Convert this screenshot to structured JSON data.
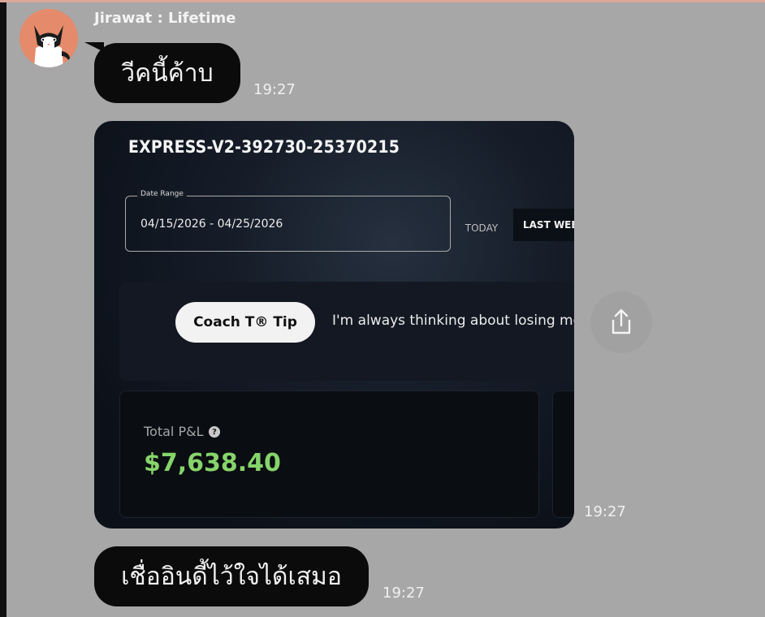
{
  "chat": {
    "sender": "Jirawat : Lifetime",
    "messages": [
      {
        "text": "วีคนี้ค้าบ",
        "time": "19:27"
      },
      {
        "time": "19:27"
      },
      {
        "text": "เชื่ออินดี้ไว้ใจได้เสมอ",
        "time": "19:27"
      }
    ]
  },
  "shared_image": {
    "account_id": "EXPRESS-V2-392730-25370215",
    "date_range_label": "Date Range",
    "date_range_value": "04/15/2026 - 04/25/2026",
    "today_label": "TODAY",
    "last_week_label": "LAST WEEK",
    "coach_tip_label": "Coach T® Tip",
    "coach_tip_text": "I'm always thinking about losing mor",
    "total_pl_label": "Total P&L",
    "help_symbol": "?",
    "total_pl_value": "$7,638.40"
  },
  "icons": {
    "avatar": "cat-avatar-icon",
    "share": "share-icon"
  },
  "colors": {
    "chat_background": "#a7a7a7",
    "bubble": "#0b0b0b",
    "profit_green": "#86d46a",
    "avatar_bg": "#e58a6a"
  }
}
